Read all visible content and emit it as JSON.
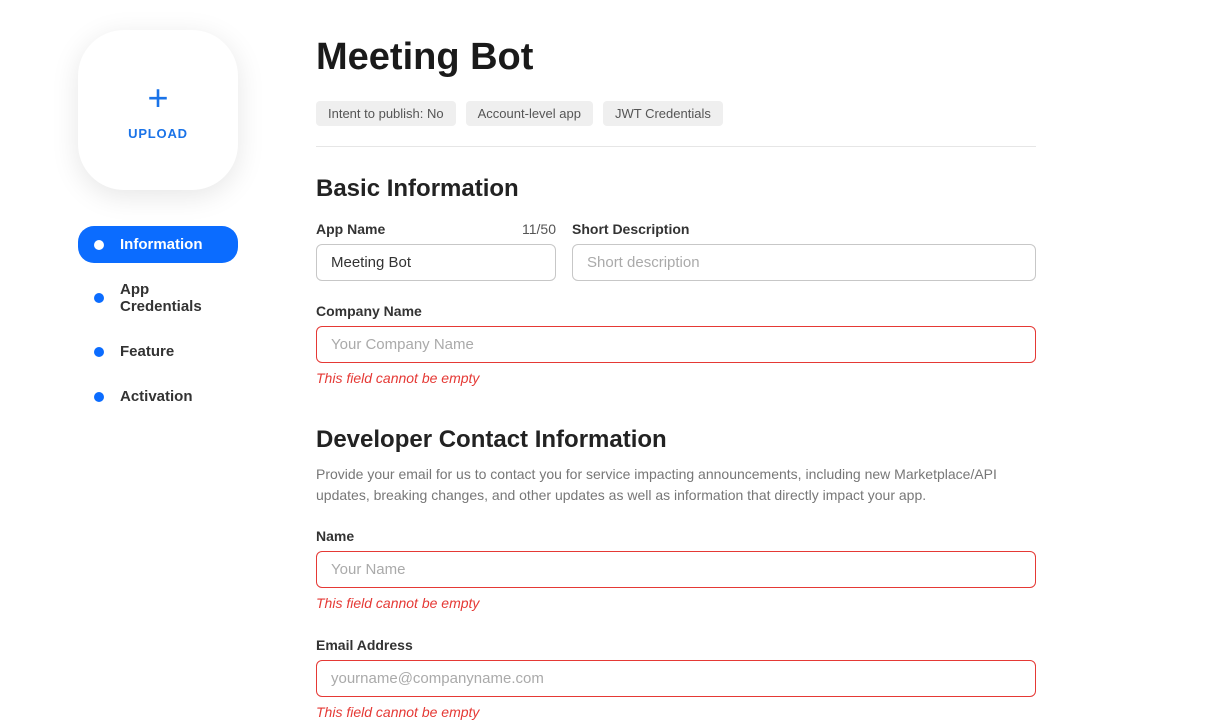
{
  "sidebar": {
    "upload_label": "UPLOAD",
    "nav": [
      {
        "label": "Information",
        "active": true
      },
      {
        "label": "App Credentials",
        "active": false
      },
      {
        "label": "Feature",
        "active": false
      },
      {
        "label": "Activation",
        "active": false
      }
    ]
  },
  "page": {
    "title": "Meeting Bot",
    "tags": [
      "Intent to publish: No",
      "Account-level app",
      "JWT Credentials"
    ]
  },
  "basic": {
    "section_title": "Basic Information",
    "app_name": {
      "label": "App Name",
      "counter": "11/50",
      "value": "Meeting Bot"
    },
    "short_desc": {
      "label": "Short Description",
      "placeholder": "Short description",
      "value": ""
    },
    "company": {
      "label": "Company Name",
      "placeholder": "Your Company Name",
      "value": "",
      "error": "This field cannot be empty"
    }
  },
  "contact": {
    "section_title": "Developer Contact Information",
    "description": "Provide your email for us to contact you for service impacting announcements, including new Marketplace/API updates, breaking changes, and other updates as well as information that directly impact your app.",
    "name": {
      "label": "Name",
      "placeholder": "Your Name",
      "value": "",
      "error": "This field cannot be empty"
    },
    "email": {
      "label": "Email Address",
      "placeholder": "yourname@companyname.com",
      "value": "",
      "error": "This field cannot be empty"
    }
  }
}
